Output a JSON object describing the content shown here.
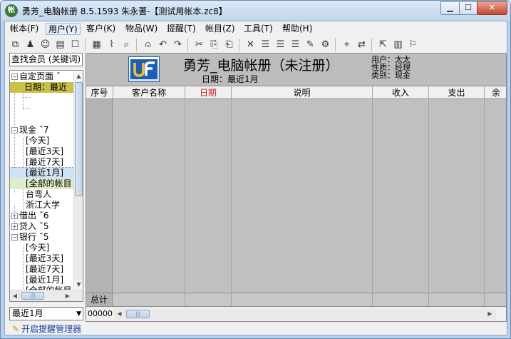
{
  "window": {
    "title": "勇芳_电脑帐册   8.5.1593  朱永蓍-【测试用帐本.zc8】",
    "app_icon_glyph": "帐",
    "minimize_glyph": "▁",
    "maximize_glyph": "☐",
    "close_glyph": "✕"
  },
  "menu": [
    "帐本(F)",
    "用户(Y)",
    "客户(K)",
    "物品(W)",
    "提醒(T)",
    "帐目(Z)",
    "工具(T)",
    "帮助(H)"
  ],
  "toolbar_icons": [
    {
      "name": "copy-window-icon",
      "glyph": "⧉"
    },
    {
      "name": "user-icon",
      "glyph": "♟"
    },
    {
      "name": "users-icon",
      "glyph": "☺"
    },
    {
      "name": "customer-icon",
      "glyph": "▤"
    },
    {
      "name": "message-icon",
      "glyph": "☐"
    },
    {
      "name": "grid-icon",
      "glyph": "▦"
    },
    {
      "name": "chart-icon",
      "glyph": "⌇"
    },
    {
      "name": "preview-icon",
      "glyph": "⌕"
    },
    {
      "name": "lock-icon",
      "glyph": "⍝"
    },
    {
      "name": "undo-icon",
      "glyph": "↶"
    },
    {
      "name": "redo-icon",
      "glyph": "↷"
    },
    {
      "name": "cut-icon",
      "glyph": "✂"
    },
    {
      "name": "copy-icon",
      "glyph": "⎘"
    },
    {
      "name": "paste-icon",
      "glyph": "⎗"
    },
    {
      "name": "delete-icon",
      "glyph": "✕"
    },
    {
      "name": "list-indent-icon",
      "glyph": "☰"
    },
    {
      "name": "list-outdent-icon",
      "glyph": "☰"
    },
    {
      "name": "list-sort-icon",
      "glyph": "☰"
    },
    {
      "name": "edit-icon",
      "glyph": "✎"
    },
    {
      "name": "settings-icon",
      "glyph": "⚙"
    },
    {
      "name": "find-icon",
      "glyph": "⌖"
    },
    {
      "name": "replace-icon",
      "glyph": "⇄"
    },
    {
      "name": "export-icon",
      "glyph": "⇱"
    },
    {
      "name": "calculator-icon",
      "glyph": "▥"
    },
    {
      "name": "flag-icon",
      "glyph": "⚐"
    }
  ],
  "sidebar": {
    "search_label": "查找会员 (关键词)",
    "period_select": "最近1月",
    "tree": [
      {
        "label": "自定页面 ˇ",
        "kind": "group",
        "expander": "−"
      },
      {
        "label": "日期：最近",
        "kind": "child-yellow"
      },
      {
        "label": "",
        "kind": "blank"
      },
      {
        "label": "",
        "kind": "blank"
      },
      {
        "label": "",
        "kind": "spacer"
      },
      {
        "label": "现金 ˇ7",
        "kind": "group",
        "expander": "−"
      },
      {
        "label": "[今天]",
        "kind": "child"
      },
      {
        "label": "[最近3天]",
        "kind": "child"
      },
      {
        "label": "[最近7天]",
        "kind": "child"
      },
      {
        "label": "[最近1月]",
        "kind": "child-blue"
      },
      {
        "label": "[全部的帐目",
        "kind": "child-green"
      },
      {
        "label": "台弯人",
        "kind": "child"
      },
      {
        "label": "浙江大学",
        "kind": "child"
      },
      {
        "label": "借出 ˇ6",
        "kind": "group",
        "expander": "+"
      },
      {
        "label": "贷入 ˇ5",
        "kind": "group",
        "expander": "+"
      },
      {
        "label": "银行 ˇ5",
        "kind": "group",
        "expander": "−"
      },
      {
        "label": "[今天]",
        "kind": "child"
      },
      {
        "label": "[最近3天]",
        "kind": "child"
      },
      {
        "label": "[最近7天]",
        "kind": "child"
      },
      {
        "label": "[最近1月]",
        "kind": "child"
      },
      {
        "label": "[全部的帐目",
        "kind": "child"
      }
    ]
  },
  "ledger": {
    "book_title": "勇芳_电脑帐册（未注册）",
    "date_line": "日期：最近1月",
    "info": [
      "用户：太太",
      "性质：经理",
      "类别：现金"
    ],
    "columns": [
      "序号",
      "客户名称",
      "日期",
      "说明",
      "收入",
      "支出",
      "余"
    ],
    "total_label": "总计",
    "count_label": "00000"
  },
  "status": {
    "reminder_link": "开启提醒管理器",
    "reminder_icon": "✎"
  }
}
